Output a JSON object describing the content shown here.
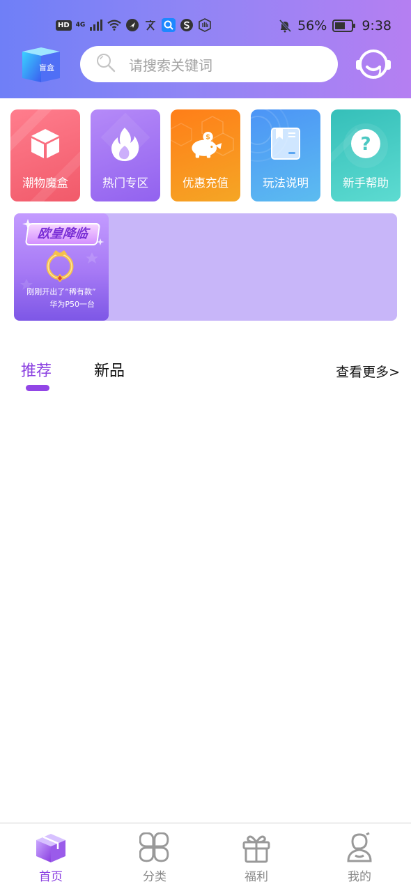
{
  "status_bar": {
    "hd": "HD",
    "network": "4G",
    "battery_pct": "56%",
    "time": "9:38"
  },
  "header": {
    "logo_text": "盲盒",
    "search_placeholder": "请搜索关键词",
    "icons": {
      "search": "search-icon",
      "service": "customer-service-icon"
    }
  },
  "tiles": [
    {
      "label": "潮物魔盒",
      "icon": "box-icon",
      "color_from": "#ff7a8a",
      "color_to": "#f25f6d"
    },
    {
      "label": "热门专区",
      "icon": "flame-icon",
      "color_from": "#b07cf7",
      "color_to": "#8f5cf0"
    },
    {
      "label": "优惠充值",
      "icon": "piggy-bank-icon",
      "color_from": "#ff8a1c",
      "color_to": "#f5a323"
    },
    {
      "label": "玩法说明",
      "icon": "book-icon",
      "color_from": "#4f9bf5",
      "color_to": "#5bb8f0"
    },
    {
      "label": "新手帮助",
      "icon": "help-icon",
      "color_from": "#39c3bd",
      "color_to": "#5ad9cf"
    }
  ],
  "banner": {
    "title": "欧皇降临",
    "line1": "刚刚开出了“稀有款”",
    "line2": "华为P50一台",
    "bg": "#c8b6f9"
  },
  "section": {
    "tabs": [
      {
        "label": "推荐",
        "active": true
      },
      {
        "label": "新品",
        "active": false
      }
    ],
    "see_more": "查看更多>"
  },
  "bottom_nav": [
    {
      "label": "首页",
      "icon": "home-box-icon",
      "active": true
    },
    {
      "label": "分类",
      "icon": "category-icon",
      "active": false
    },
    {
      "label": "福利",
      "icon": "gift-icon",
      "active": false
    },
    {
      "label": "我的",
      "icon": "profile-icon",
      "active": false
    }
  ],
  "colors": {
    "accent": "#8a3fe0",
    "header_from": "#6f7ff7",
    "header_to": "#b57ff2"
  }
}
